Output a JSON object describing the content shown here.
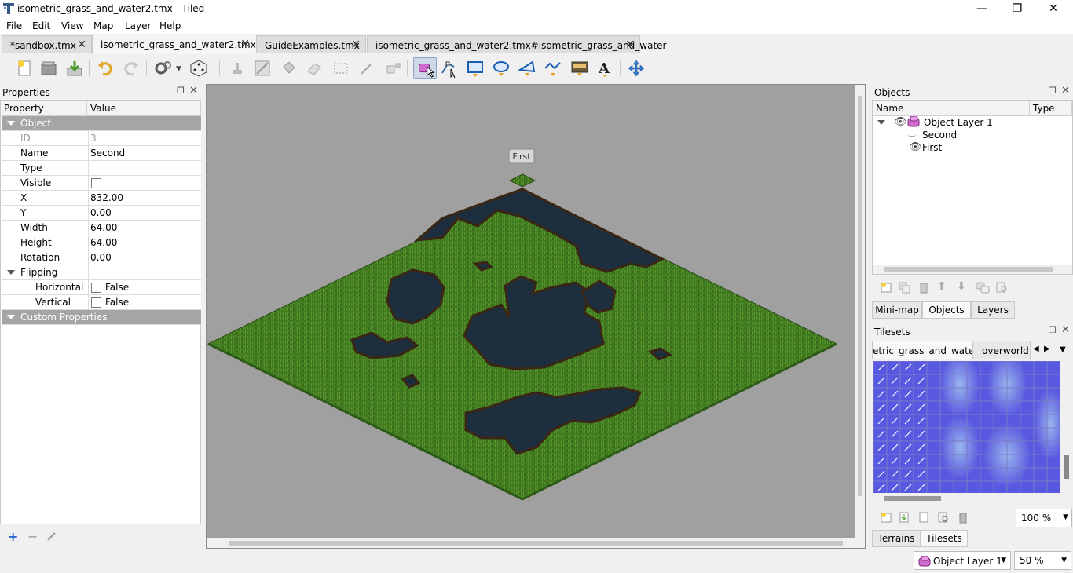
{
  "window": {
    "title": "isometric_grass_and_water2.tmx - Tiled",
    "controls": [
      "minimize",
      "restore",
      "close"
    ]
  },
  "menu": [
    "File",
    "Edit",
    "View",
    "Map",
    "Layer",
    "Help"
  ],
  "tabs": [
    {
      "label": "*sandbox.tmx",
      "active": false
    },
    {
      "label": "isometric_grass_and_water2.tmx",
      "active": true
    },
    {
      "label": "GuideExamples.tmx",
      "active": false
    },
    {
      "label": "isometric_grass_and_water2.tmx#isometric_grass_and_water",
      "active": false
    }
  ],
  "toolbar": {
    "buttons": [
      "new-icon",
      "open-icon",
      "save-icon",
      "undo-icon",
      "redo-icon",
      "commands-icon",
      "random-icon",
      "stamp-icon",
      "terrain-brush-icon",
      "bucket-fill-icon",
      "eraser-icon",
      "rect-select-icon",
      "magic-wand-icon",
      "select-same-icon",
      "select-objects-icon",
      "edit-polygons-icon",
      "insert-rectangle-icon",
      "insert-ellipse-icon",
      "insert-polygon-icon",
      "insert-polyline-icon",
      "insert-tile-icon",
      "insert-text-icon",
      "move-icon"
    ],
    "selected": "select-objects-icon"
  },
  "properties": {
    "title": "Properties",
    "col_property": "Property",
    "col_value": "Value",
    "group_object": "Object",
    "rows": [
      {
        "key": "ID",
        "value": "3",
        "dim": true
      },
      {
        "key": "Name",
        "value": "Second"
      },
      {
        "key": "Type",
        "value": ""
      },
      {
        "key": "Visible",
        "value": "",
        "checkbox": true
      },
      {
        "key": "X",
        "value": "832.00"
      },
      {
        "key": "Y",
        "value": "0.00"
      },
      {
        "key": "Width",
        "value": "64.00"
      },
      {
        "key": "Height",
        "value": "64.00"
      },
      {
        "key": "Rotation",
        "value": "0.00"
      }
    ],
    "group_flipping": "Flipping",
    "flip_rows": [
      {
        "key": "Horizontal",
        "value": "False"
      },
      {
        "key": "Vertical",
        "value": "False"
      }
    ],
    "group_custom": "Custom Properties"
  },
  "map": {
    "object_label": "First"
  },
  "objects": {
    "title": "Objects",
    "col_name": "Name",
    "col_type": "Type",
    "layer": "Object Layer 1",
    "items": [
      "Second",
      "First"
    ]
  },
  "dock_tabs": [
    "Mini-map",
    "Objects",
    "Layers"
  ],
  "tilesets": {
    "title": "Tilesets",
    "tabs": [
      "etric_grass_and_water",
      "overworld"
    ],
    "zoom": "100 %"
  },
  "bottom_tabs": [
    "Terrains",
    "Tilesets"
  ],
  "status": {
    "layer": "Object Layer 1",
    "zoom": "50 %"
  }
}
